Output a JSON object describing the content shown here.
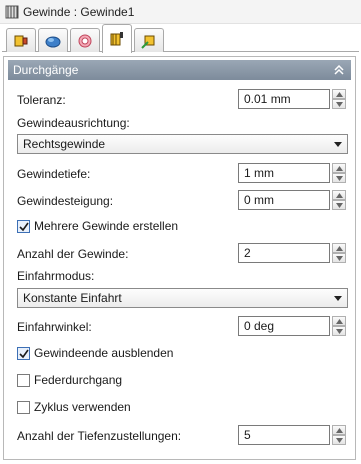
{
  "window": {
    "title": "Gewinde : Gewinde1"
  },
  "tabs": [
    {
      "name": "tab-1",
      "icon": "thread-feature-icon",
      "active": false
    },
    {
      "name": "tab-2",
      "icon": "blue-swirl-icon",
      "active": false
    },
    {
      "name": "tab-3",
      "icon": "pink-rings-icon",
      "active": false
    },
    {
      "name": "tab-4",
      "icon": "thread-yellow-icon",
      "active": true
    },
    {
      "name": "tab-5",
      "icon": "thread-green-icon",
      "active": false
    }
  ],
  "section": {
    "title": "Durchgänge",
    "collapse_icon": "double-chevron-up-icon"
  },
  "fields": {
    "toleranz": {
      "label": "Toleranz:",
      "value": "0.01 mm"
    },
    "ausrichtung": {
      "label": "Gewindeausrichtung:",
      "value": "Rechtsgewinde"
    },
    "tiefe": {
      "label": "Gewindetiefe:",
      "value": "1 mm"
    },
    "steigung": {
      "label": "Gewindesteigung:",
      "value": "0 mm"
    },
    "mehrere": {
      "label": "Mehrere Gewinde erstellen",
      "checked": true
    },
    "anzahl": {
      "label": "Anzahl der Gewinde:",
      "value": "2"
    },
    "einfahrmodus": {
      "label": "Einfahrmodus:",
      "value": "Konstante Einfahrt"
    },
    "einfahrwinkel": {
      "label": "Einfahrwinkel:",
      "value": "0 deg"
    },
    "ausblenden": {
      "label": "Gewindeende ausblenden",
      "checked": true
    },
    "feder": {
      "label": "Federdurchgang",
      "checked": false
    },
    "zyklus": {
      "label": "Zyklus verwenden",
      "checked": false
    },
    "tiefenzustellungen": {
      "label": "Anzahl der Tiefenzustellungen:",
      "value": "5"
    }
  }
}
